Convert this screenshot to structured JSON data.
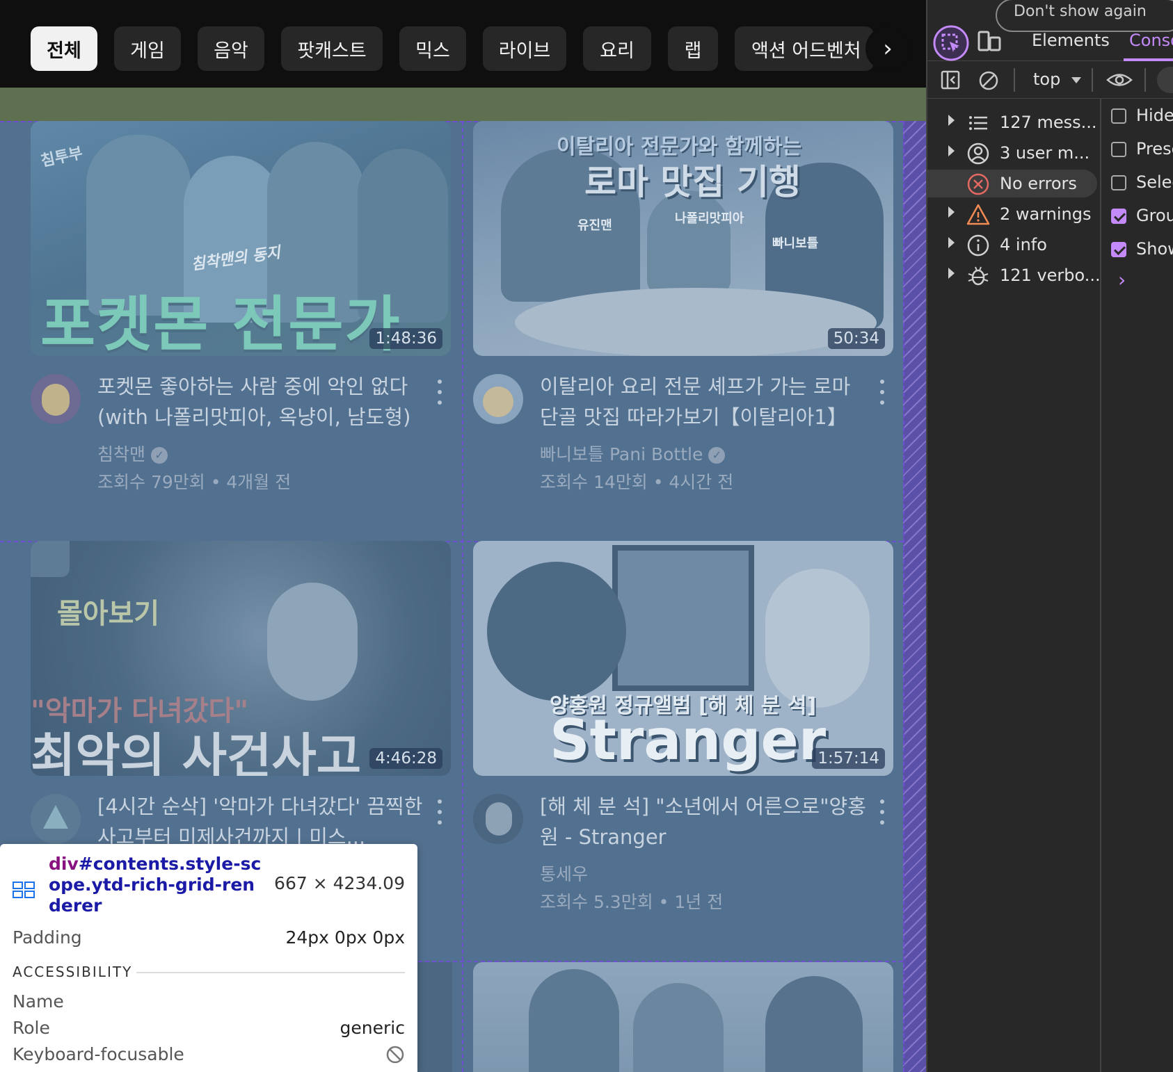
{
  "chips": [
    "전체",
    "게임",
    "음악",
    "팟캐스트",
    "믹스",
    "라이브",
    "요리",
    "랩",
    "액션 어드벤처 게임"
  ],
  "chip_next_glyph": "›",
  "videos": [
    {
      "thumb_caption_small": "침착맨의 동지",
      "thumb_logo": "침투부",
      "thumb_caption_big": "포켓몬 전문가",
      "duration": "1:48:36",
      "title": "포켓몬 좋아하는 사람 중에 악인 없다 (with 나폴리맛피아, 옥냥이, 남도형)",
      "channel": "침착맨",
      "verified": true,
      "meta": "조회수 79만회 • 4개월 전"
    },
    {
      "thumb_caption_small": "이탈리아 전문가와 함께하는",
      "thumb_caption_big": "로마 맛집 기행",
      "thumb_tag_a": "나폴리맛피아",
      "thumb_tag_b": "빠니보틀",
      "thumb_tag_c": "유진맨",
      "duration": "50:34",
      "title": "이탈리아 요리 전문 셰프가 가는 로마 단골 맛집 따라가보기【이탈리아1】",
      "channel": "빠니보틀 Pani Bottle",
      "verified": true,
      "meta": "조회수 14만회 • 4시간 전"
    },
    {
      "thumb_caption_small": "몰아보기",
      "thumb_caption_quote": "\"악마가 다녀갔다\"",
      "thumb_caption_big": "최악의 사건사고",
      "duration": "4:46:28",
      "title": "[4시간 순삭] '악마가 다녀갔다' 끔찍한 사고부터 미제사건까지 | 미스...",
      "channel": "",
      "verified": false,
      "meta": ""
    },
    {
      "thumb_caption_small": "양홍원 정규앨범 [해 체 분 석]",
      "thumb_caption_big": "Stranger",
      "duration": "1:57:14",
      "title": "[해 체 분 석] \"소년에서 어른으로\"양홍원 - Stranger",
      "channel": "통세우",
      "verified": false,
      "meta": "조회수 5.3만회 • 1년 전"
    }
  ],
  "tooltip": {
    "selector_tag": "div",
    "selector_rest": "#contents.style-scope.ytd-rich-grid-renderer",
    "size": "667 × 4234.09",
    "padding_label": "Padding",
    "padding_value": "24px 0px 0px",
    "accessibility_heading": "ACCESSIBILITY",
    "name_label": "Name",
    "name_value": "",
    "role_label": "Role",
    "role_value": "generic",
    "focus_label": "Keyboard-focusable"
  },
  "devtools": {
    "banner_text": "Don't show again",
    "tabs": [
      "Elements",
      "Console"
    ],
    "active_tab": "Console",
    "context": "top",
    "sidebar": [
      {
        "label": "127 mess...",
        "icon": "list-icon",
        "expandable": true,
        "selected": false
      },
      {
        "label": "3 user m...",
        "icon": "user-icon",
        "expandable": true,
        "selected": false
      },
      {
        "label": "No errors",
        "icon": "error-icon",
        "expandable": false,
        "selected": true
      },
      {
        "label": "2 warnings",
        "icon": "warning-icon",
        "expandable": true,
        "selected": false
      },
      {
        "label": "4 info",
        "icon": "info-icon",
        "expandable": true,
        "selected": false
      },
      {
        "label": "121 verbo...",
        "icon": "bug-icon",
        "expandable": true,
        "selected": false
      }
    ],
    "settings": [
      {
        "label": "Hide network",
        "checked": false
      },
      {
        "label": "Preserve log",
        "checked": false
      },
      {
        "label": "Selected context only",
        "checked": false
      },
      {
        "label": "Group similar messages in console",
        "checked": true
      },
      {
        "label": "Show CORS errors in console",
        "checked": true
      }
    ],
    "prompt_glyph": "›"
  },
  "colors": {
    "overlay_blue": "#52708f",
    "hatch_purple": "#5b50a8",
    "accent_purple": "#c58af9",
    "error_red": "#e46962",
    "warning_orange": "#f28b54"
  }
}
